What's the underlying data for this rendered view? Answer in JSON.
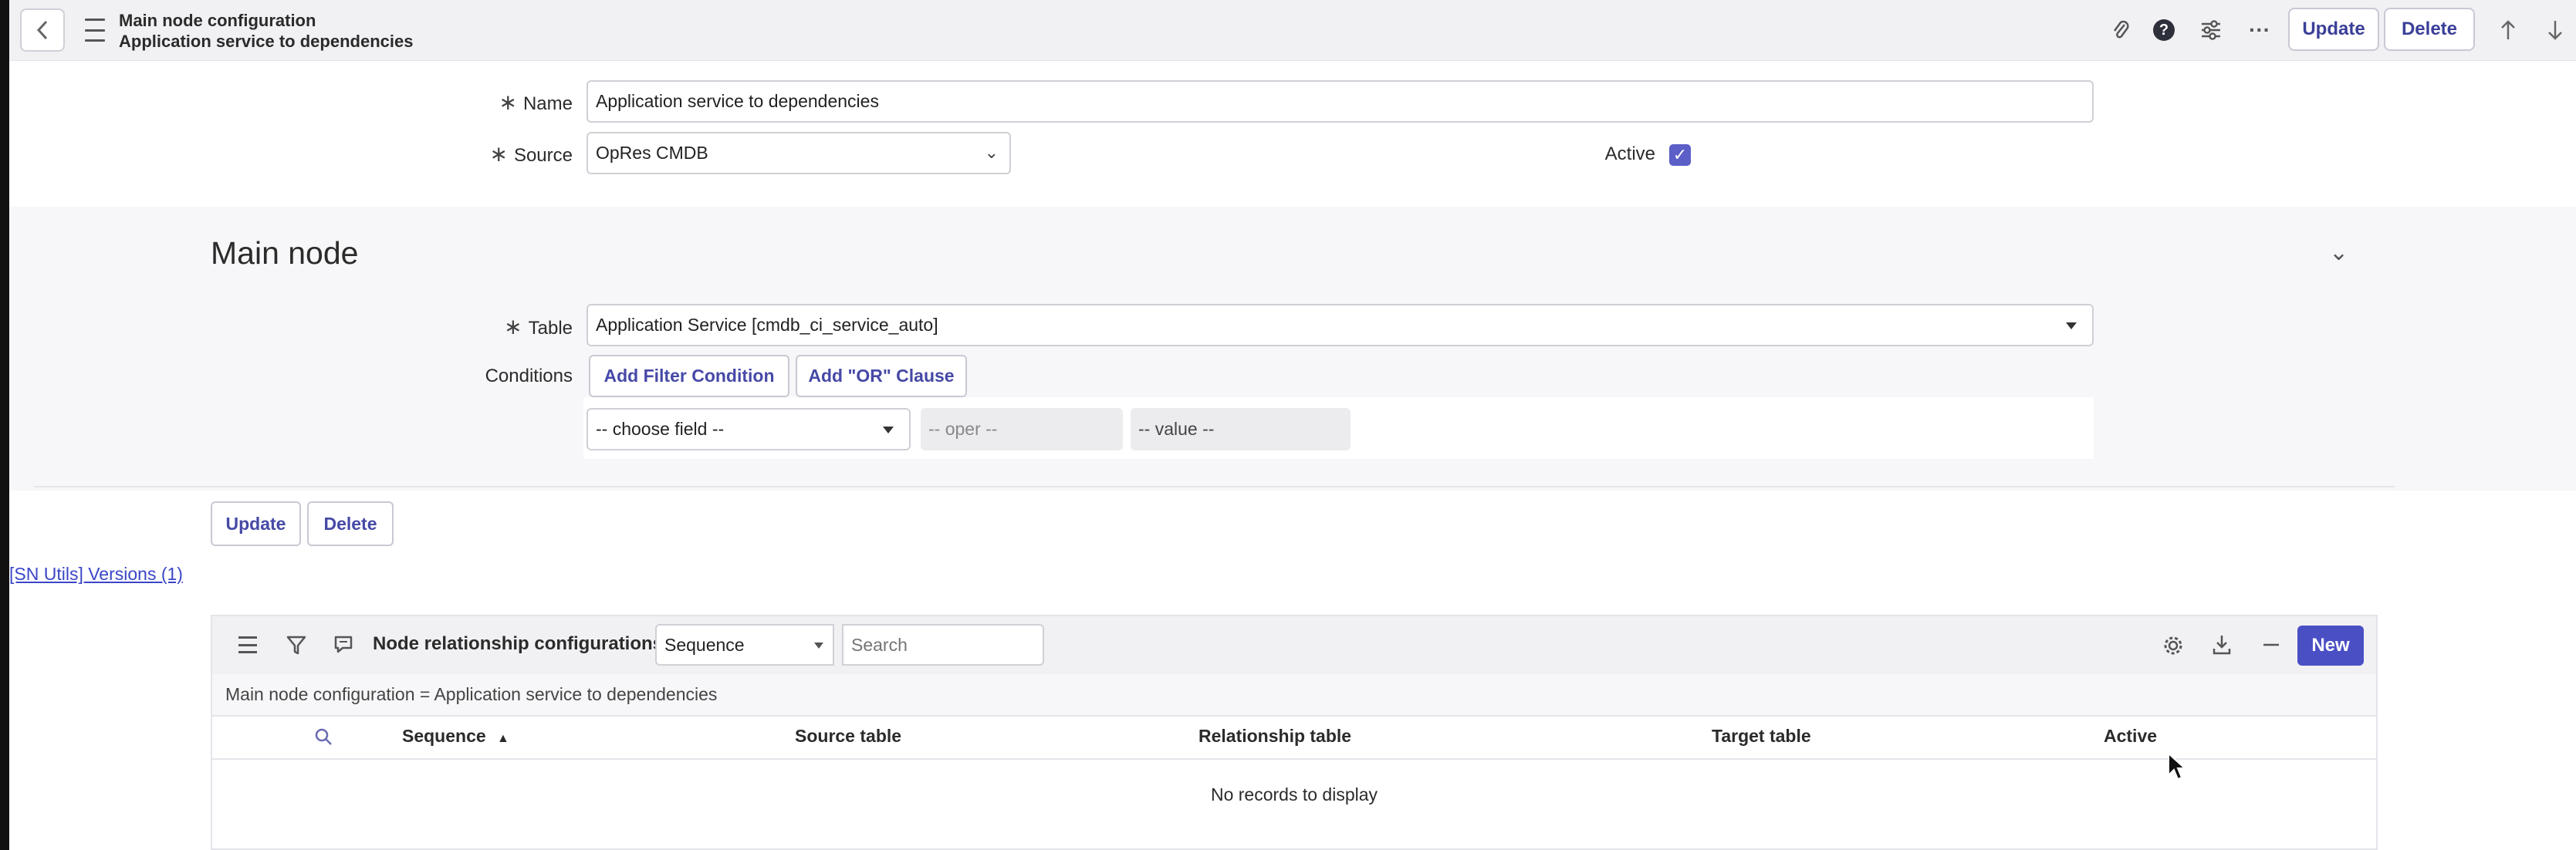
{
  "header": {
    "title_line1": "Main node configuration",
    "title_line2": "Application service to dependencies",
    "update_label": "Update",
    "delete_label": "Delete"
  },
  "form": {
    "name_label": "Name",
    "name_value": "Application service to dependencies",
    "source_label": "Source",
    "source_value": "OpRes CMDB",
    "active_label": "Active",
    "active_checked": true
  },
  "main_node": {
    "title": "Main node",
    "table_label": "Table",
    "table_value": "Application Service [cmdb_ci_service_auto]",
    "conditions_label": "Conditions",
    "add_filter_label": "Add Filter Condition",
    "add_or_label": "Add \"OR\" Clause",
    "choose_field_value": "-- choose field --",
    "oper_value": "-- oper --",
    "value_value": "-- value --"
  },
  "footer_buttons": {
    "update_label": "Update",
    "delete_label": "Delete"
  },
  "versions_link": "[SN Utils] Versions (1)",
  "related_list": {
    "title": "Node relationship configurations",
    "search_field_value": "Sequence",
    "search_placeholder": "Search",
    "new_label": "New",
    "breadcrumb": "Main node configuration = Application service to dependencies",
    "columns": [
      "Sequence",
      "Source table",
      "Relationship table",
      "Target table",
      "Active"
    ],
    "empty_message": "No records to display"
  },
  "colors": {
    "accent": "#4b4fc4",
    "link": "#3b46c7",
    "header_bg": "#f1f1f4"
  }
}
